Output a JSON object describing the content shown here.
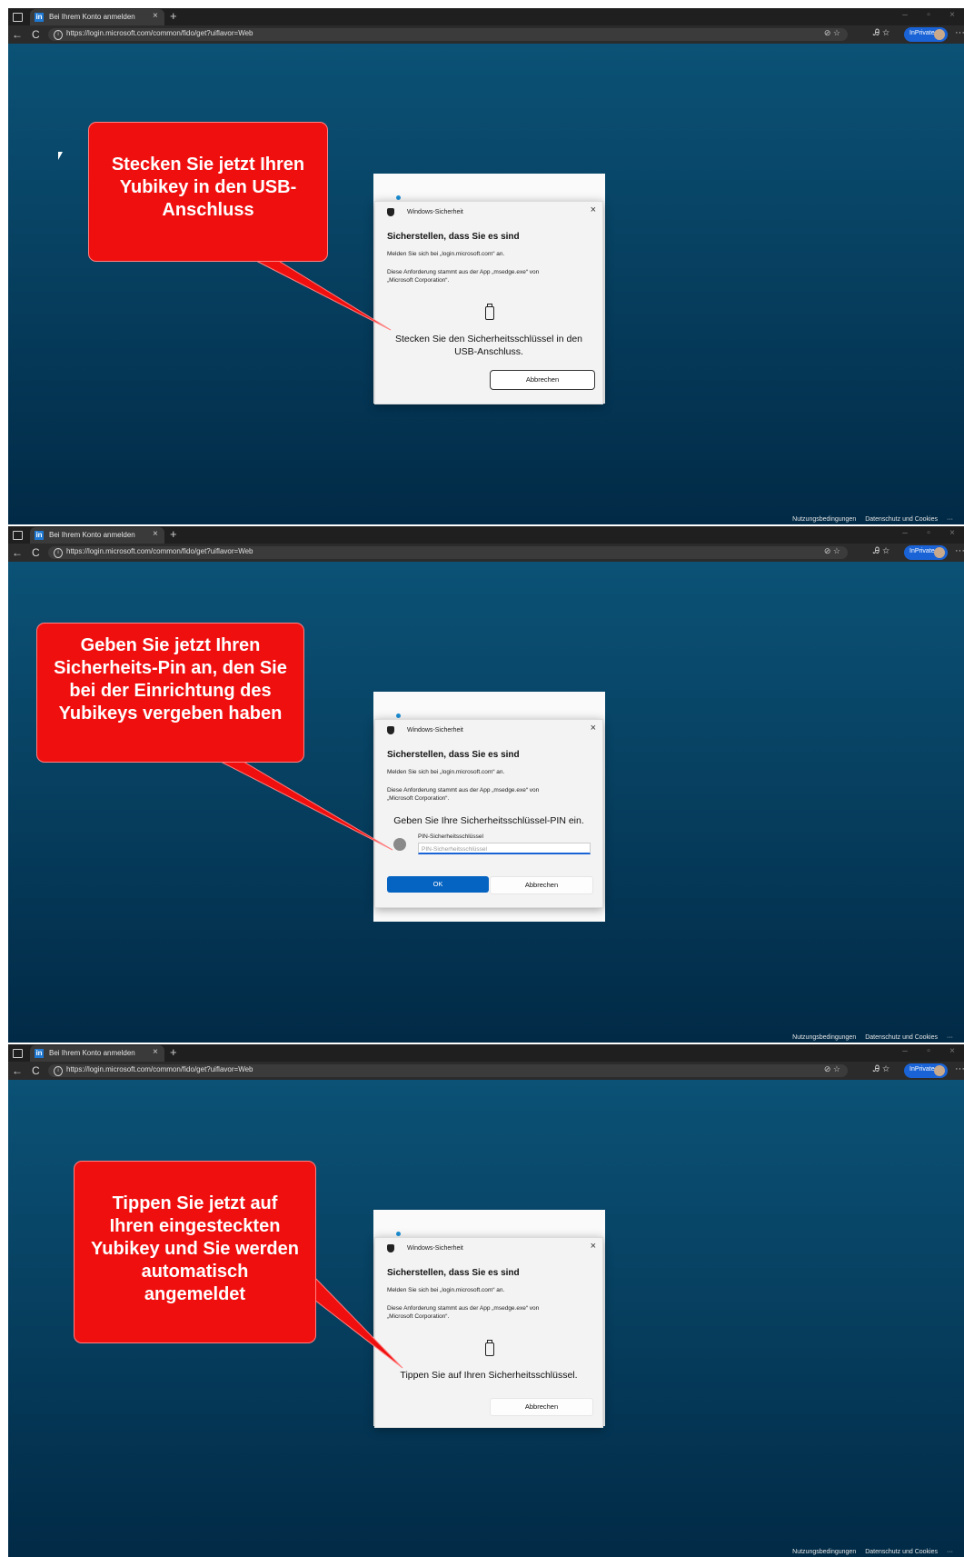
{
  "browser": {
    "tab_title": "Bei Ihrem Konto anmelden",
    "tab_close": "×",
    "new_tab": "+",
    "url": "https://login.microsoft.com/common/fido/get?uiflavor=Web",
    "inprivate_label": "InPrivate",
    "more": "···",
    "nav_back": "←",
    "nav_reload": "C"
  },
  "footer": {
    "terms": "Nutzungsbedingungen",
    "privacy": "Datenschutz und Cookies",
    "more": "···"
  },
  "dialog": {
    "app_name": "Windows-Sicherheit",
    "title": "Sicherstellen, dass Sie es sind",
    "signin_line": "Melden Sie sich bei „login.microsoft.com“ an.",
    "request_line1": "Diese Anforderung stammt aus der App „msedge.exe“ von",
    "request_line2": "„Microsoft Corporation“.",
    "close": "×",
    "cancel_label": "Abbrechen",
    "ok_label": "OK"
  },
  "steps": [
    {
      "message": "Stecken Sie den Sicherheitsschlüssel in den USB-Anschluss.",
      "callout": "Stecken Sie jetzt Ihren Yubikey in den USB-Anschluss"
    },
    {
      "message": "Geben Sie Ihre Sicherheitsschlüssel-PIN ein.",
      "pin_label": "PIN-Sicherheitsschlüssel",
      "pin_placeholder": "PIN-Sicherheitsschlüssel",
      "callout": "Geben Sie jetzt Ihren Sicherheits-Pin an, den Sie bei der Einrichtung des Yubikeys vergeben haben"
    },
    {
      "message": "Tippen Sie auf Ihren Sicherheitsschlüssel.",
      "callout": "Tippen Sie jetzt auf Ihren eingesteckten Yubikey und Sie werden automatisch angemeldet"
    }
  ]
}
